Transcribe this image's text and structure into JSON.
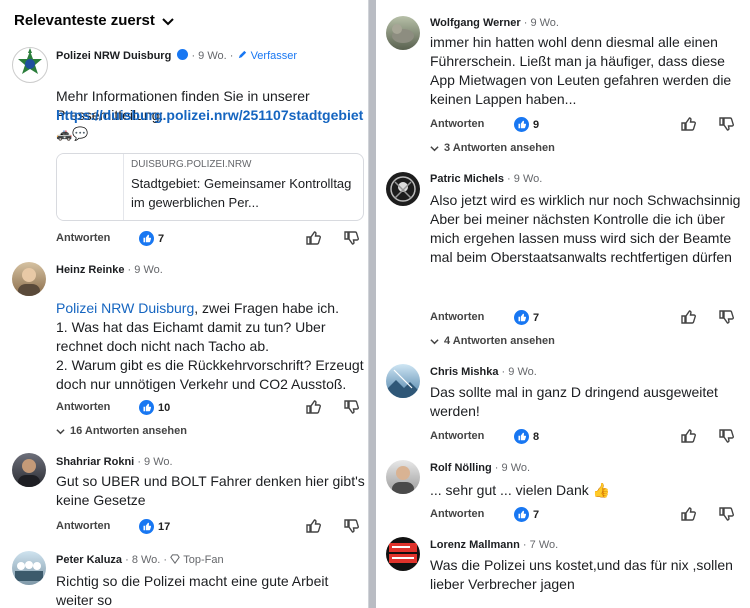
{
  "sort": {
    "label": "Relevanteste zuerst"
  },
  "common": {
    "reply_label": "Antworten"
  },
  "left": {
    "post": {
      "name": "Polizei NRW Duisburg",
      "age": "9 Wo.",
      "author_tag": "Verfasser",
      "text": "Mehr Informationen finden Sie in unserer Pressemitteilung:",
      "link": "https://duisburg.polizei.nrw/251107stadtgebiet",
      "emoji": "🚓💬",
      "card_domain": "DUISBURG.POLIZEI.NRW",
      "card_title": "Stadtgebiet: Gemeinsamer Kontrolltag im gewerblichen Per...",
      "likes": "7"
    },
    "c1": {
      "name": "Heinz Reinke",
      "age": "9 Wo.",
      "mention": "Polizei NRW Duisburg",
      "text_after_mention": ", zwei Fragen habe ich.",
      "text": "1. Was hat das Eichamt damit zu tun? Uber rechnet doch nicht nach Tacho ab.\n2. Warum gibt es die Rückkehrvorschrift? Erzeugt doch nur unnötigen Verkehr und CO2 Ausstoß.",
      "likes": "10",
      "replies": "16 Antworten ansehen"
    },
    "c2": {
      "name": "Shahriar Rokni",
      "age": "9 Wo.",
      "text": "Gut so UBER und BOLT Fahrer denken hier gibt's keine Gesetze",
      "likes": "17"
    },
    "c3": {
      "name": "Peter Kaluza",
      "age": "8 Wo.",
      "badge": "Top-Fan",
      "text": "Richtig so die Polizei macht eine gute Arbeit weiter so"
    }
  },
  "right": {
    "c1": {
      "name": "Wolfgang Werner",
      "age": "9 Wo.",
      "text": "immer hin hatten wohl denn diesmal alle einen Führerschein. Ließt man ja häufiger, dass diese App Mietwagen von Leuten gefahren werden die keinen Lappen haben...",
      "likes": "9",
      "replies": "3 Antworten ansehen"
    },
    "c2": {
      "name": "Patric Michels",
      "age": "9 Wo.",
      "text": "Also jetzt wird es wirklich nur noch Schwachsinnig\nAber bei meiner nächsten Kontrolle die ich über mich ergehen lassen muss wird sich der Beamte mal beim Oberstaatsanwalts rechtfertigen dürfen",
      "likes": "7",
      "replies": "4 Antworten ansehen"
    },
    "c3": {
      "name": "Chris Mishka",
      "age": "9 Wo.",
      "text": "Das sollte mal in ganz D dringend ausgeweitet werden!",
      "likes": "8"
    },
    "c4": {
      "name": "Rolf Nölling",
      "age": "9 Wo.",
      "text": "... sehr gut ... vielen Dank 👍",
      "likes": "7"
    },
    "c5": {
      "name": "Lorenz Mallmann",
      "age": "7 Wo.",
      "text": "Was die Polizei uns kostet,und das für nix ,sollen lieber Verbrecher jagen"
    }
  },
  "colors": {
    "accent": "#1877f2",
    "link": "#1565c0",
    "meta": "#65676b"
  }
}
